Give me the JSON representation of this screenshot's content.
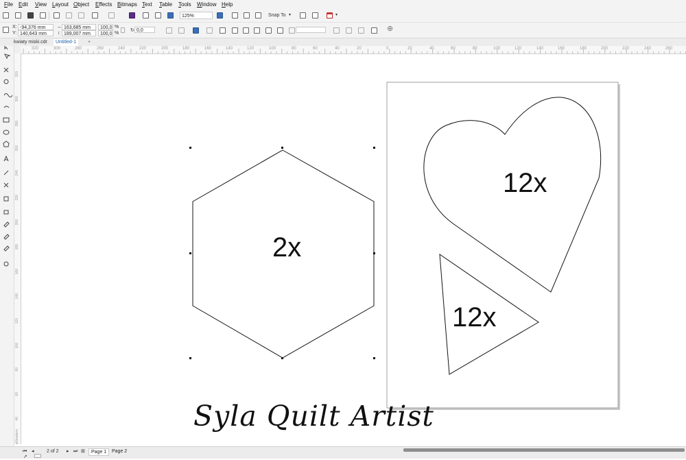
{
  "menu": [
    "File",
    "Edit",
    "View",
    "Layout",
    "Object",
    "Effects",
    "Bitmaps",
    "Text",
    "Table",
    "Tools",
    "Window",
    "Help"
  ],
  "toolbar": {
    "zoom": "125%",
    "snap_to": "Snap To"
  },
  "property_bar": {
    "x_label": "X:",
    "x_value": "-94,376 mm",
    "y_label": "Y:",
    "y_value": "140,643 mm",
    "width_value": "163,685 mm",
    "height_value": "189,007 mm",
    "scale_x": "100,0",
    "scale_y": "100,0",
    "percent": "%",
    "rotation": "0,0"
  },
  "doc_tabs": [
    "kwiaty miski.cdr",
    "Untitled-1"
  ],
  "ruler": {
    "h_labels": [
      "320",
      "300",
      "280",
      "260",
      "240",
      "220",
      "200",
      "180",
      "160",
      "140",
      "120",
      "100",
      "80",
      "60",
      "40",
      "20",
      "0",
      "20",
      "40",
      "60",
      "80",
      "100",
      "120",
      "140",
      "160",
      "180",
      "200",
      "220",
      "240",
      "260",
      "280"
    ],
    "v_labels": [
      "320",
      "300",
      "280",
      "260",
      "240",
      "220",
      "200",
      "180",
      "160",
      "140",
      "120",
      "100",
      "80",
      "60",
      "40",
      "20",
      "0"
    ],
    "unit": "millimeters"
  },
  "shapes": {
    "hexagon_label": "2x",
    "heart_label": "12x",
    "triangle_label": "12x"
  },
  "statusbar": {
    "page_count": "2 of 2",
    "pages": [
      "Page 1",
      "Page 2"
    ]
  },
  "watermark": "Syla Quilt Artist",
  "colors": {
    "ui_background": "#f3f3f3",
    "canvas": "#ffffff",
    "outline": "#111111",
    "active_tab_text": "#1d5fa8"
  }
}
